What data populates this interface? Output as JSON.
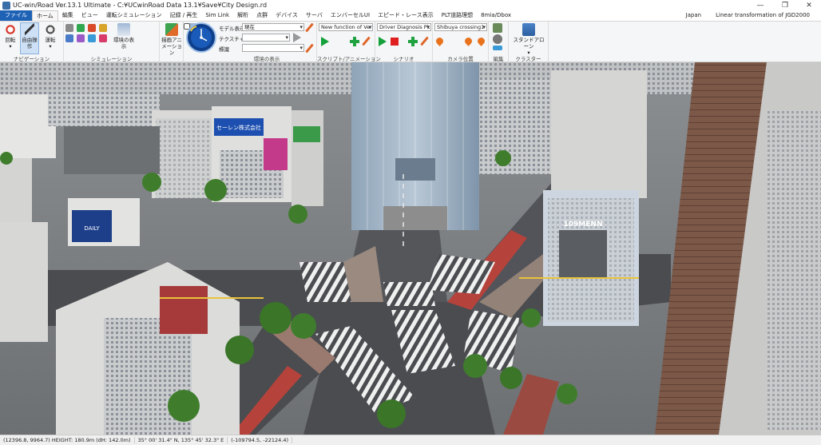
{
  "window": {
    "title": "UC-win/Road Ver.13.1 Ultimate - C:¥UCwinRoad Data 13.1¥Save¥City Design.rd",
    "minimize": "—",
    "maximize": "❐",
    "close": "✕"
  },
  "menu": {
    "tabs": [
      "ファイル",
      "ホーム",
      "編集",
      "ビュー",
      "運転シミュレーション",
      "記録 / 再生",
      "Sim Link",
      "解析",
      "点群",
      "デバイス",
      "サーバ",
      "エンバーセルUI",
      "エピード・レース表示",
      "PLT道路理想",
      "8mia/Dbox"
    ],
    "region": "Japan",
    "transform": "Linear transformation of JGD2000"
  },
  "ribbon": {
    "navigation": {
      "label": "ナビゲーション",
      "rotate": "回転",
      "free": "自由操作",
      "drive": "運転"
    },
    "simulation": {
      "label": "シミュレーション",
      "env_display": "環境の表示",
      "draw_anim": "描画アニメーション",
      "weather": "天候"
    },
    "environment": {
      "label": "環境の表示",
      "model_label": "モデル表示",
      "model_value": "現在",
      "texture_label": "テクスチャ",
      "texture_value": "",
      "mark_label": "標識",
      "mark_value": ""
    },
    "script": {
      "label": "スクリプト/アニメーション",
      "value": "New function of Ver"
    },
    "scenario": {
      "label": "シナリオ",
      "value": "Driver Diagnosis Pk"
    },
    "camera": {
      "label": "カメラ位置",
      "value": "Shibuya crossing1"
    },
    "edit": {
      "label": "編集"
    },
    "cluster": {
      "label": "クラスター",
      "standalone": "スタンドアローン"
    }
  },
  "status": {
    "position": "(12396.8, 9964.7) HEIGHT: 180.9m (dH: 142.0m)",
    "latlon": "35° 00' 31.4\" N, 135° 45' 32.3\" E",
    "coords": "(-109794.5, -22124.4)"
  },
  "scene": {
    "sign_selen": "セーレン株式会社",
    "sign_109": "109MENN",
    "sign_daily": "DAILY"
  },
  "colors": {
    "accent": "#1e62b6",
    "road": "#4a4c50",
    "sidewalk": "#9a7a6e",
    "bus_lane": "#b5433b",
    "crosswalk": "#f0f0f0",
    "tree": "#3f7d2c"
  }
}
